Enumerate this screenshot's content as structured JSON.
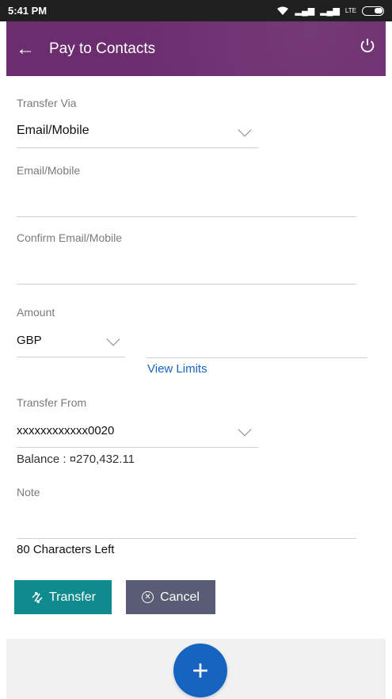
{
  "status_bar": {
    "time": "5:41 PM",
    "network_1": "▂▄▆",
    "network_2": "▂▄▆",
    "lte": "LTE"
  },
  "app_bar": {
    "title": "Pay to Contacts"
  },
  "form": {
    "transfer_via": {
      "label": "Transfer Via",
      "value": "Email/Mobile"
    },
    "email_mobile": {
      "label": "Email/Mobile",
      "value": ""
    },
    "confirm_email_mobile": {
      "label": "Confirm Email/Mobile",
      "value": ""
    },
    "amount": {
      "label": "Amount",
      "currency": "GBP",
      "value": ""
    },
    "view_limits": "View Limits",
    "transfer_from": {
      "label": "Transfer From",
      "value": "xxxxxxxxxxxx0020"
    },
    "balance": "Balance : ¤270,432.11",
    "note": {
      "label": "Note",
      "value": ""
    },
    "characters_left": "80 Characters Left"
  },
  "buttons": {
    "transfer": "Transfer",
    "cancel": "Cancel"
  },
  "colors": {
    "app_bar": "#6c2d6f",
    "transfer_button": "#0f8a8f",
    "cancel_button": "#5a5b74",
    "link": "#1565c0",
    "fab": "#1565c0"
  },
  "icons": {
    "back": "arrow-left-icon",
    "power": "power-icon",
    "transfer": "transfer-icon",
    "cancel": "close-circle-icon",
    "fab": "plus-icon"
  }
}
